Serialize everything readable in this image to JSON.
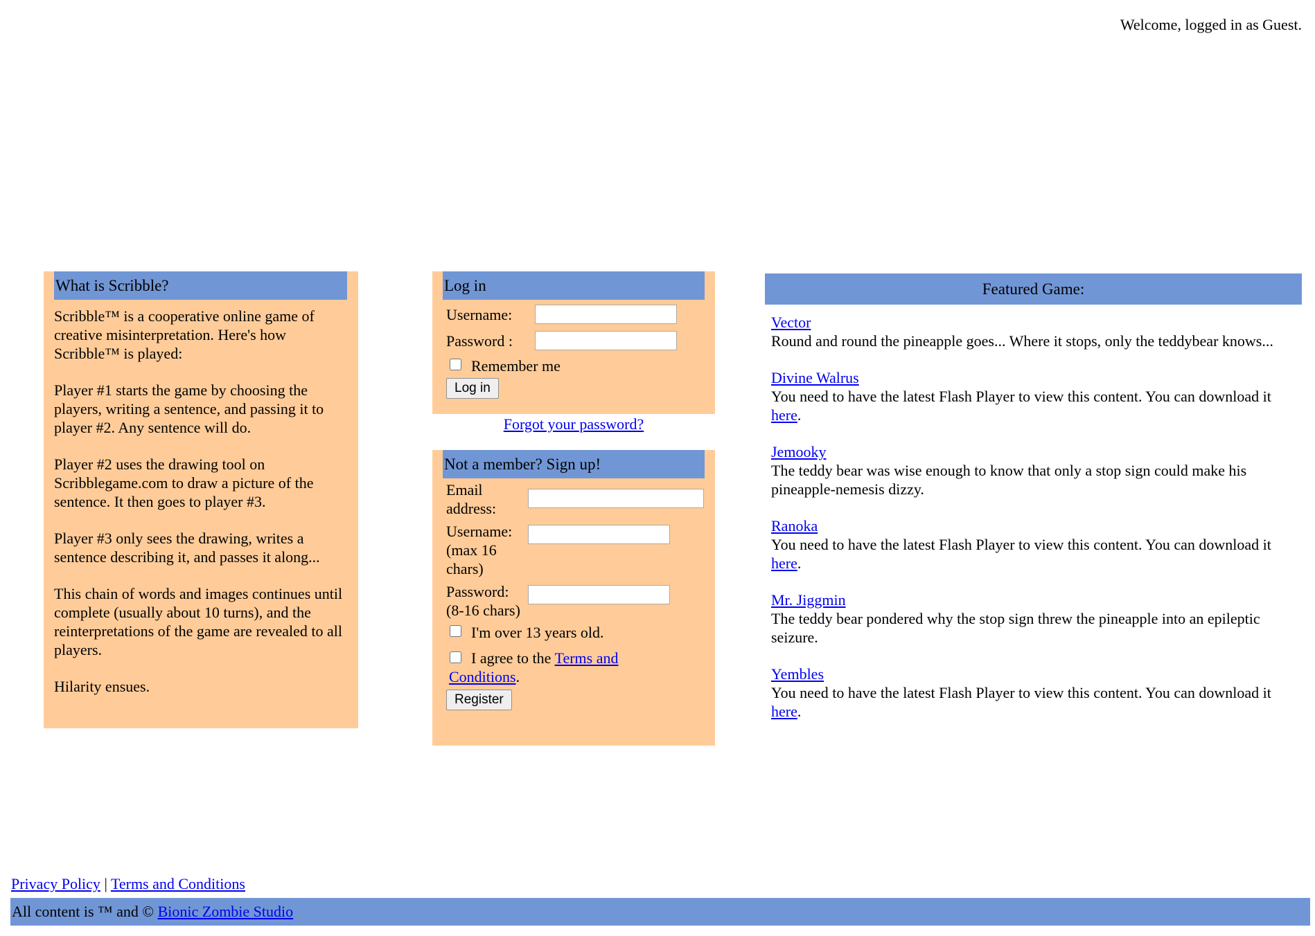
{
  "header": {
    "welcome": "Welcome, logged in as Guest."
  },
  "about": {
    "title": "What is Scribble?",
    "paragraphs": [
      "Scribble™ is a cooperative online game of creative misinterpretation. Here's how Scribble™ is played:",
      "Player #1 starts the game by choosing the players, writing a sentence, and passing it to player #2. Any sentence will do.",
      "Player #2 uses the drawing tool on Scribblegame.com to draw a picture of the sentence. It then goes to player #3.",
      "Player #3 only sees the drawing, writes a sentence describing it, and passes it along...",
      "This chain of words and images continues until complete (usually about 10 turns), and the reinterpretations of the game are revealed to all players.",
      "Hilarity ensues."
    ]
  },
  "login": {
    "title": "Log in",
    "username_label": "Username:",
    "username_value": "",
    "password_label": "Password :",
    "password_value": "",
    "remember_label": "Remember me",
    "submit_label": "Log in",
    "forgot_link": "Forgot your password?"
  },
  "signup": {
    "title": "Not a member? Sign up!",
    "email_label": "Email address:",
    "email_value": "",
    "username_label": "Username: (max 16 chars)",
    "username_value": "",
    "password_label": "Password: (8-16 chars)",
    "password_value": "",
    "age_label": "I'm over 13 years old.",
    "agree_prefix": "I agree to the ",
    "terms_link": "Terms and Conditions",
    "agree_suffix": ".",
    "submit_label": "Register"
  },
  "featured": {
    "title": "Featured Game:",
    "flash_text": "You need to have the latest Flash Player to view this content. You can download it ",
    "flash_link": "here",
    "flash_suffix": ".",
    "games": [
      {
        "name": "Vector",
        "desc": "Round and round the pineapple goes... Where it stops, only the teddybear knows..."
      },
      {
        "name": "Divine Walrus"
      },
      {
        "name": "Jemooky",
        "desc": "The teddy bear was wise enough to know that only a stop sign could make his pineapple-nemesis dizzy."
      },
      {
        "name": "Ranoka"
      },
      {
        "name": "Mr. Jiggmin",
        "desc": "The teddy bear pondered why the stop sign threw the pineapple into an epileptic seizure."
      },
      {
        "name": "Yembles"
      }
    ]
  },
  "footer": {
    "privacy_link": "Privacy Policy",
    "separator": "|",
    "terms_link": "Terms and Conditions",
    "copyright_prefix": "All content is ™ and © ",
    "studio_link": "Bionic Zombie Studio"
  },
  "colors": {
    "panel_bg": "#ffcc99",
    "header_bg": "#7196d5",
    "link": "#0000ee"
  }
}
